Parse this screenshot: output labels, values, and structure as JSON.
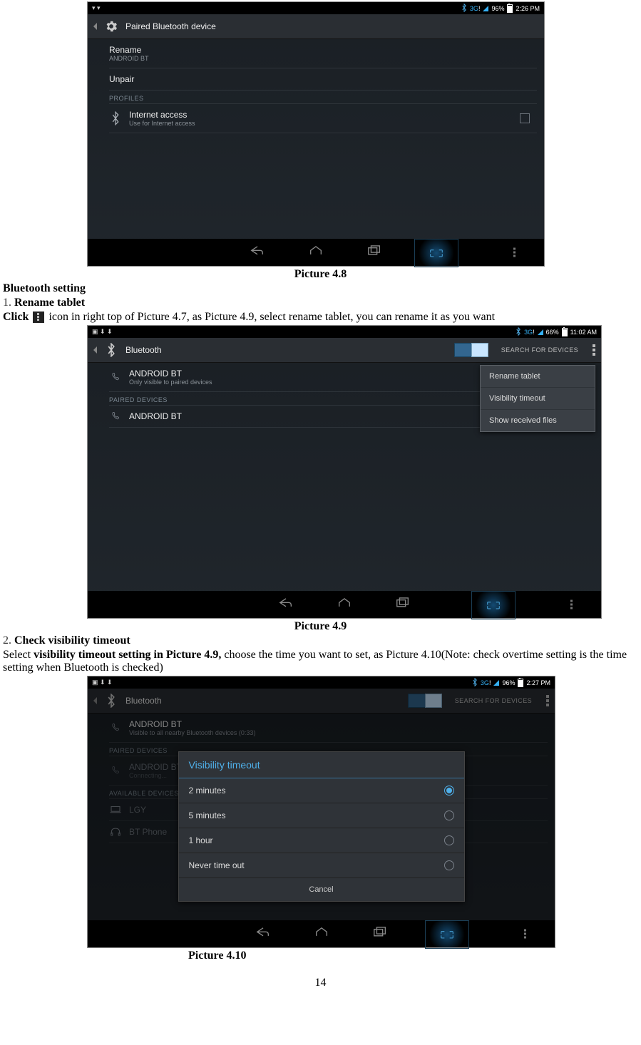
{
  "captions": {
    "p48": "Picture 4.8",
    "p49": "Picture 4.9",
    "p410": "Picture 4.10"
  },
  "text": {
    "heading": "Bluetooth setting",
    "item1_num": "1.",
    "item1_title": "Rename tablet",
    "line1_pre": "Click ",
    "line1_post": " icon in right top of Picture 4.7, as Picture 4.9, select rename tablet, you can rename it as you want",
    "item2_num": "2.",
    "item2_title": " Check visibility timeout",
    "line2a_pre": "Select ",
    "line2a_bold": "visibility timeout setting in Picture 4.9, ",
    "line2a_post": "choose the time you want to set, as Picture 4.10(Note: check overtime setting is the time setting when Bluetooth is checked)",
    "page_number": "14"
  },
  "shot48": {
    "status": {
      "net": "3G",
      "batt_pct": "96%",
      "time": "2:26 PM"
    },
    "header": {
      "title": "Paired Bluetooth device"
    },
    "rows": {
      "rename_label": "Rename",
      "rename_value": "ANDROID BT",
      "unpair": "Unpair",
      "section": "PROFILES",
      "profile_name": "Internet access",
      "profile_desc": "Use for Internet access"
    }
  },
  "shot49": {
    "status": {
      "net": "3G",
      "batt_pct": "66%",
      "time": "11:02 AM"
    },
    "header": {
      "title": "Bluetooth",
      "search": "SEARCH FOR DEVICES"
    },
    "rows": {
      "self_name": "ANDROID BT",
      "self_sub": "Only visible to paired devices",
      "section": "PAIRED DEVICES",
      "paired_name": "ANDROID BT"
    },
    "menu": {
      "rename": "Rename tablet",
      "visibility": "Visibility timeout",
      "received": "Show received files"
    }
  },
  "shot410": {
    "status": {
      "net": "3G",
      "batt_pct": "96%",
      "time": "2:27 PM"
    },
    "header": {
      "title": "Bluetooth",
      "search": "SEARCH FOR DEVICES"
    },
    "rows": {
      "self_name": "ANDROID BT",
      "self_sub": "Visible to all nearby Bluetooth devices (0:33)",
      "section_paired": "PAIRED DEVICES",
      "paired_name": "ANDROID BT",
      "paired_sub": "Connecting...",
      "section_avail": "AVAILABLE DEVICES",
      "avail1": "LGY",
      "avail2": "BT Phone"
    },
    "dialog": {
      "title": "Visibility timeout",
      "opt1": "2 minutes",
      "opt2": "5 minutes",
      "opt3": "1 hour",
      "opt4": "Never time out",
      "cancel": "Cancel"
    }
  }
}
